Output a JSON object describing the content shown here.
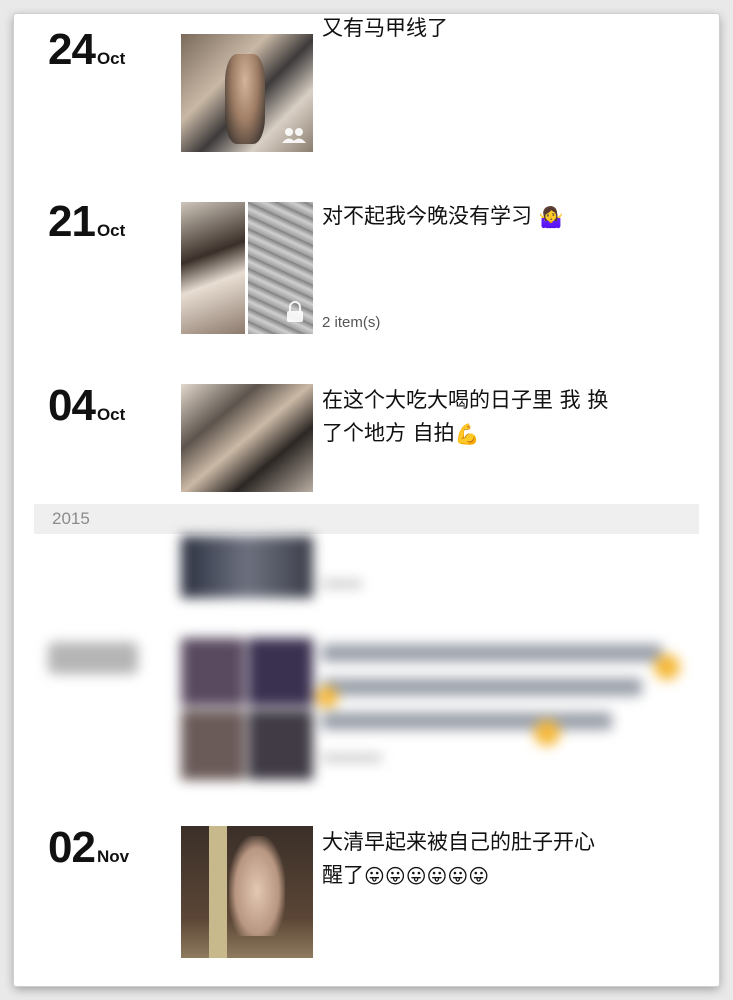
{
  "entries": [
    {
      "day": "24",
      "month": "Oct",
      "text": "又有马甲线了",
      "count": ""
    },
    {
      "day": "21",
      "month": "Oct",
      "text": "对不起我今晚没有学习",
      "emoji": "🤷‍♀️",
      "count": "2 item(s)"
    },
    {
      "day": "04",
      "month": "Oct",
      "text_line1": "在这个大吃大喝的日子里 我 换",
      "text_line2": "了个地方 自拍",
      "emoji": "💪",
      "count": ""
    },
    {
      "day": "02",
      "month": "Nov",
      "text_line1": "大清早起来被自己的肚子开心",
      "text_line2": "醒了",
      "emoji": "😛😛😛😛😛😛",
      "count": ""
    }
  ],
  "year_header": "2015",
  "icons": {
    "friends": "friends-icon",
    "lock": "lock-icon"
  }
}
